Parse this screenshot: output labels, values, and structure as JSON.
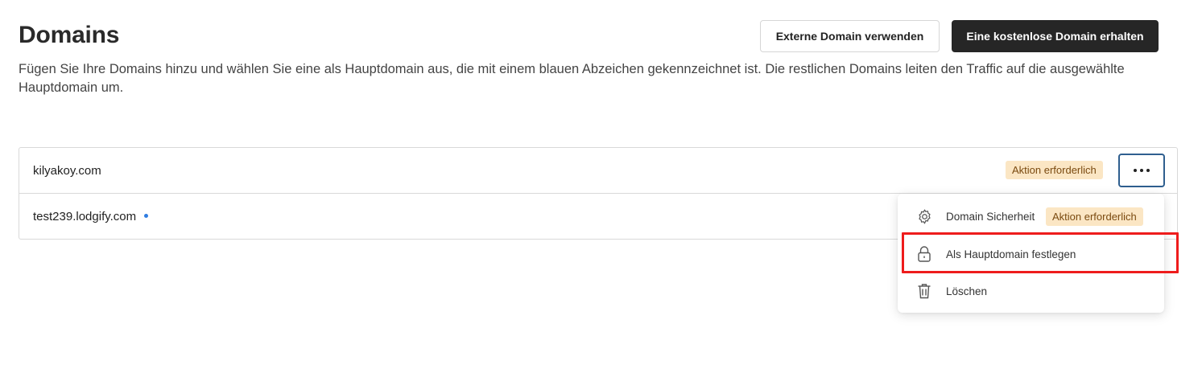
{
  "header": {
    "title": "Domains",
    "description": "Fügen Sie Ihre Domains hinzu und wählen Sie eine als Hauptdomain aus, die mit einem blauen Abzeichen gekennzeichnet ist. Die restlichen Domains leiten den Traffic auf die ausgewählte Hauptdomain um.",
    "external_domain_button": "Externe Domain verwenden",
    "free_domain_button": "Eine kostenlose Domain erhalten"
  },
  "domains": [
    {
      "name": "kilyakoy.com",
      "badge": "Aktion erforderlich",
      "is_primary": false
    },
    {
      "name": "test239.lodgify.com",
      "badge": "",
      "is_primary": true
    }
  ],
  "more_button": {
    "icon": "more-horizontal-icon"
  },
  "menu": {
    "items": [
      {
        "label": "Domain Sicherheit",
        "icon": "gear-icon",
        "badge": "Aktion erforderlich"
      },
      {
        "label": "Als Hauptdomain festlegen",
        "icon": "lock-icon"
      },
      {
        "label": "Löschen",
        "icon": "trash-icon"
      }
    ]
  },
  "colors": {
    "primary_button": "#262626",
    "badge_background": "#fbe6c4",
    "badge_text": "#7a4a10",
    "primary_dot": "#2f7de1",
    "focus_border": "#2f5f8f",
    "highlight": "#ee1c1c"
  }
}
